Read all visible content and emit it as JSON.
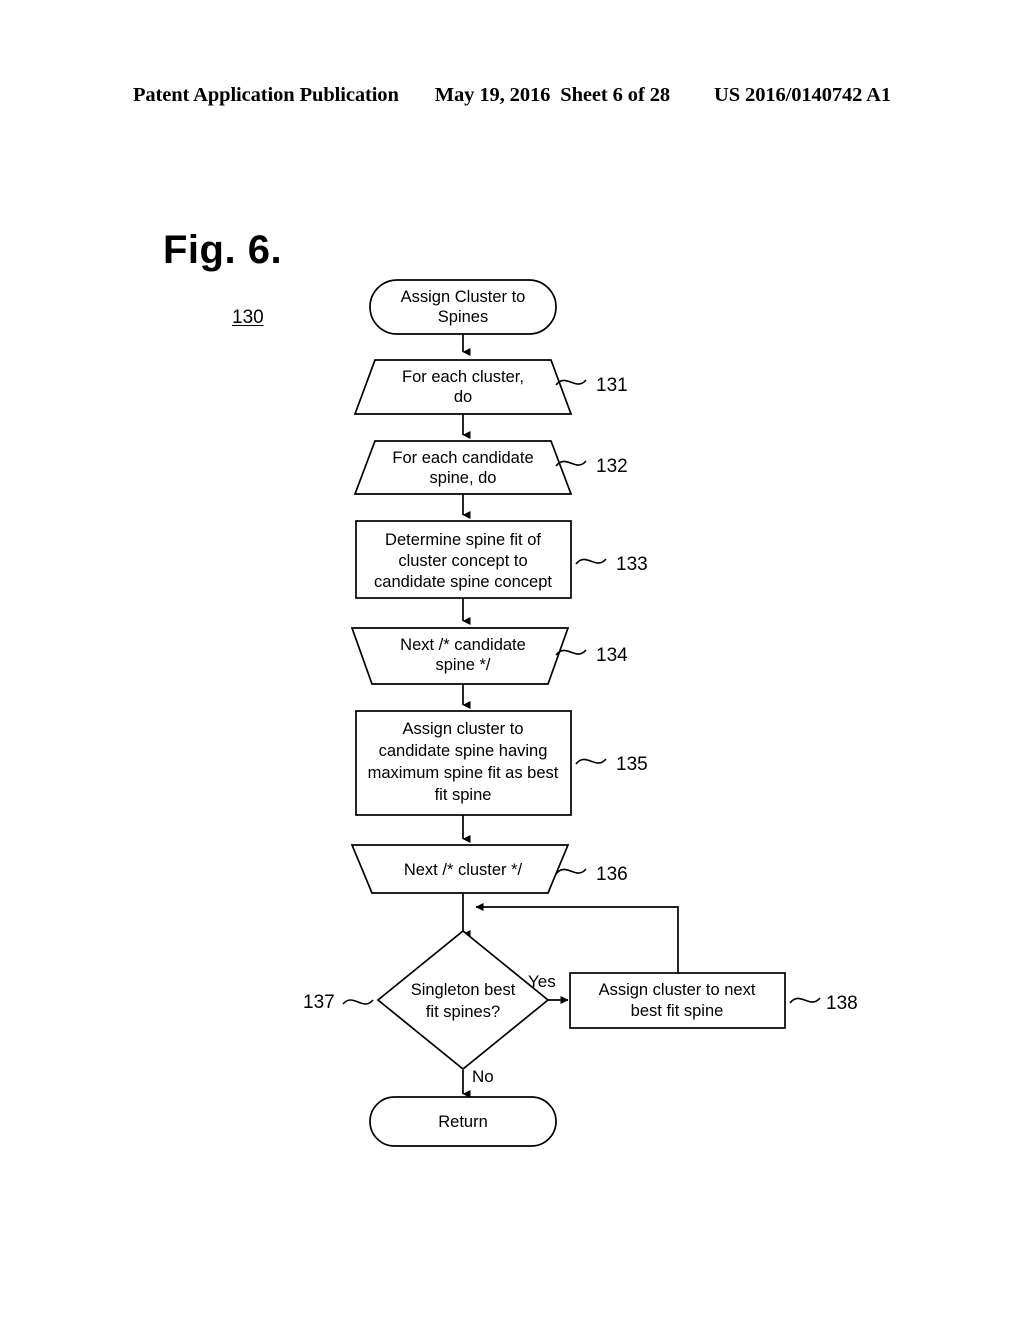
{
  "header": {
    "publication": "Patent Application Publication",
    "date": "May 19, 2016",
    "sheet": "Sheet 6 of 28",
    "pub_number": "US 2016/0140742 A1"
  },
  "figure": {
    "title": "Fig. 6.",
    "ref_label": "130"
  },
  "colors": {
    "background": "#ffffff",
    "ink": "#000000"
  },
  "flowchart": {
    "type": "flowchart",
    "nodes": [
      {
        "id": "start",
        "shape": "terminator",
        "ref": "",
        "lines": [
          "Assign Cluster to",
          "Spines"
        ]
      },
      {
        "id": "n131",
        "shape": "trapezoid-down",
        "ref": "131",
        "lines": [
          "For each cluster,",
          "do"
        ]
      },
      {
        "id": "n132",
        "shape": "trapezoid-down",
        "ref": "132",
        "lines": [
          "For each candidate",
          "spine, do"
        ]
      },
      {
        "id": "n133",
        "shape": "process",
        "ref": "133",
        "lines": [
          "Determine spine fit of",
          "cluster concept to",
          "candidate spine concept"
        ]
      },
      {
        "id": "n134",
        "shape": "trapezoid-up",
        "ref": "134",
        "lines": [
          "Next /* candidate",
          "spine */"
        ]
      },
      {
        "id": "n135",
        "shape": "process",
        "ref": "135",
        "lines": [
          "Assign cluster to",
          "candidate spine having",
          "maximum spine fit as best",
          "fit spine"
        ]
      },
      {
        "id": "n136",
        "shape": "trapezoid-up",
        "ref": "136",
        "lines": [
          "Next /* cluster */"
        ]
      },
      {
        "id": "n137",
        "shape": "decision",
        "ref": "137",
        "lines": [
          "Singleton best",
          "fit spines?"
        ]
      },
      {
        "id": "n138",
        "shape": "process",
        "ref": "138",
        "lines": [
          "Assign cluster to next",
          "best fit spine"
        ]
      },
      {
        "id": "return",
        "shape": "terminator",
        "ref": "",
        "lines": [
          "Return"
        ]
      }
    ],
    "edge_labels": {
      "yes": "Yes",
      "no": "No"
    }
  }
}
